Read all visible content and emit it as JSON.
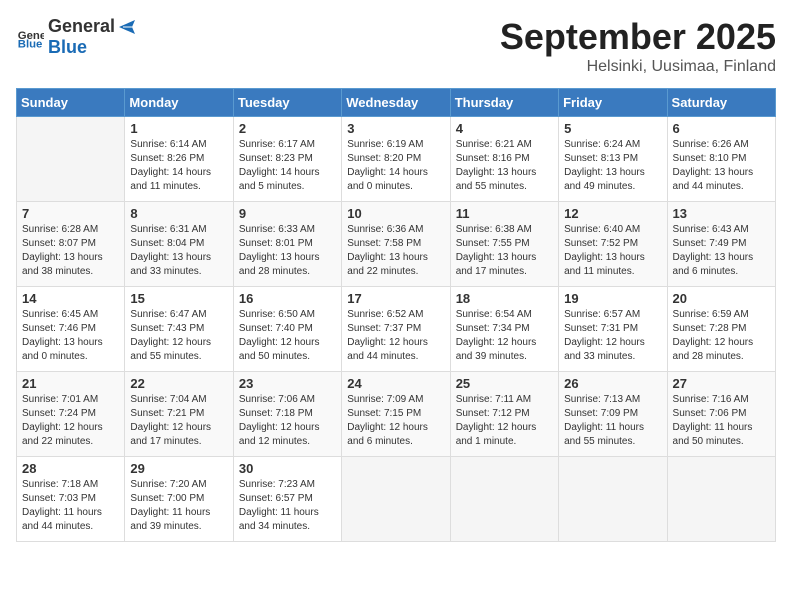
{
  "header": {
    "logo_general": "General",
    "logo_blue": "Blue",
    "month": "September 2025",
    "location": "Helsinki, Uusimaa, Finland"
  },
  "weekdays": [
    "Sunday",
    "Monday",
    "Tuesday",
    "Wednesday",
    "Thursday",
    "Friday",
    "Saturday"
  ],
  "weeks": [
    [
      {
        "day": "",
        "info": ""
      },
      {
        "day": "1",
        "info": "Sunrise: 6:14 AM\nSunset: 8:26 PM\nDaylight: 14 hours\nand 11 minutes."
      },
      {
        "day": "2",
        "info": "Sunrise: 6:17 AM\nSunset: 8:23 PM\nDaylight: 14 hours\nand 5 minutes."
      },
      {
        "day": "3",
        "info": "Sunrise: 6:19 AM\nSunset: 8:20 PM\nDaylight: 14 hours\nand 0 minutes."
      },
      {
        "day": "4",
        "info": "Sunrise: 6:21 AM\nSunset: 8:16 PM\nDaylight: 13 hours\nand 55 minutes."
      },
      {
        "day": "5",
        "info": "Sunrise: 6:24 AM\nSunset: 8:13 PM\nDaylight: 13 hours\nand 49 minutes."
      },
      {
        "day": "6",
        "info": "Sunrise: 6:26 AM\nSunset: 8:10 PM\nDaylight: 13 hours\nand 44 minutes."
      }
    ],
    [
      {
        "day": "7",
        "info": "Sunrise: 6:28 AM\nSunset: 8:07 PM\nDaylight: 13 hours\nand 38 minutes."
      },
      {
        "day": "8",
        "info": "Sunrise: 6:31 AM\nSunset: 8:04 PM\nDaylight: 13 hours\nand 33 minutes."
      },
      {
        "day": "9",
        "info": "Sunrise: 6:33 AM\nSunset: 8:01 PM\nDaylight: 13 hours\nand 28 minutes."
      },
      {
        "day": "10",
        "info": "Sunrise: 6:36 AM\nSunset: 7:58 PM\nDaylight: 13 hours\nand 22 minutes."
      },
      {
        "day": "11",
        "info": "Sunrise: 6:38 AM\nSunset: 7:55 PM\nDaylight: 13 hours\nand 17 minutes."
      },
      {
        "day": "12",
        "info": "Sunrise: 6:40 AM\nSunset: 7:52 PM\nDaylight: 13 hours\nand 11 minutes."
      },
      {
        "day": "13",
        "info": "Sunrise: 6:43 AM\nSunset: 7:49 PM\nDaylight: 13 hours\nand 6 minutes."
      }
    ],
    [
      {
        "day": "14",
        "info": "Sunrise: 6:45 AM\nSunset: 7:46 PM\nDaylight: 13 hours\nand 0 minutes."
      },
      {
        "day": "15",
        "info": "Sunrise: 6:47 AM\nSunset: 7:43 PM\nDaylight: 12 hours\nand 55 minutes."
      },
      {
        "day": "16",
        "info": "Sunrise: 6:50 AM\nSunset: 7:40 PM\nDaylight: 12 hours\nand 50 minutes."
      },
      {
        "day": "17",
        "info": "Sunrise: 6:52 AM\nSunset: 7:37 PM\nDaylight: 12 hours\nand 44 minutes."
      },
      {
        "day": "18",
        "info": "Sunrise: 6:54 AM\nSunset: 7:34 PM\nDaylight: 12 hours\nand 39 minutes."
      },
      {
        "day": "19",
        "info": "Sunrise: 6:57 AM\nSunset: 7:31 PM\nDaylight: 12 hours\nand 33 minutes."
      },
      {
        "day": "20",
        "info": "Sunrise: 6:59 AM\nSunset: 7:28 PM\nDaylight: 12 hours\nand 28 minutes."
      }
    ],
    [
      {
        "day": "21",
        "info": "Sunrise: 7:01 AM\nSunset: 7:24 PM\nDaylight: 12 hours\nand 22 minutes."
      },
      {
        "day": "22",
        "info": "Sunrise: 7:04 AM\nSunset: 7:21 PM\nDaylight: 12 hours\nand 17 minutes."
      },
      {
        "day": "23",
        "info": "Sunrise: 7:06 AM\nSunset: 7:18 PM\nDaylight: 12 hours\nand 12 minutes."
      },
      {
        "day": "24",
        "info": "Sunrise: 7:09 AM\nSunset: 7:15 PM\nDaylight: 12 hours\nand 6 minutes."
      },
      {
        "day": "25",
        "info": "Sunrise: 7:11 AM\nSunset: 7:12 PM\nDaylight: 12 hours\nand 1 minute."
      },
      {
        "day": "26",
        "info": "Sunrise: 7:13 AM\nSunset: 7:09 PM\nDaylight: 11 hours\nand 55 minutes."
      },
      {
        "day": "27",
        "info": "Sunrise: 7:16 AM\nSunset: 7:06 PM\nDaylight: 11 hours\nand 50 minutes."
      }
    ],
    [
      {
        "day": "28",
        "info": "Sunrise: 7:18 AM\nSunset: 7:03 PM\nDaylight: 11 hours\nand 44 minutes."
      },
      {
        "day": "29",
        "info": "Sunrise: 7:20 AM\nSunset: 7:00 PM\nDaylight: 11 hours\nand 39 minutes."
      },
      {
        "day": "30",
        "info": "Sunrise: 7:23 AM\nSunset: 6:57 PM\nDaylight: 11 hours\nand 34 minutes."
      },
      {
        "day": "",
        "info": ""
      },
      {
        "day": "",
        "info": ""
      },
      {
        "day": "",
        "info": ""
      },
      {
        "day": "",
        "info": ""
      }
    ]
  ]
}
